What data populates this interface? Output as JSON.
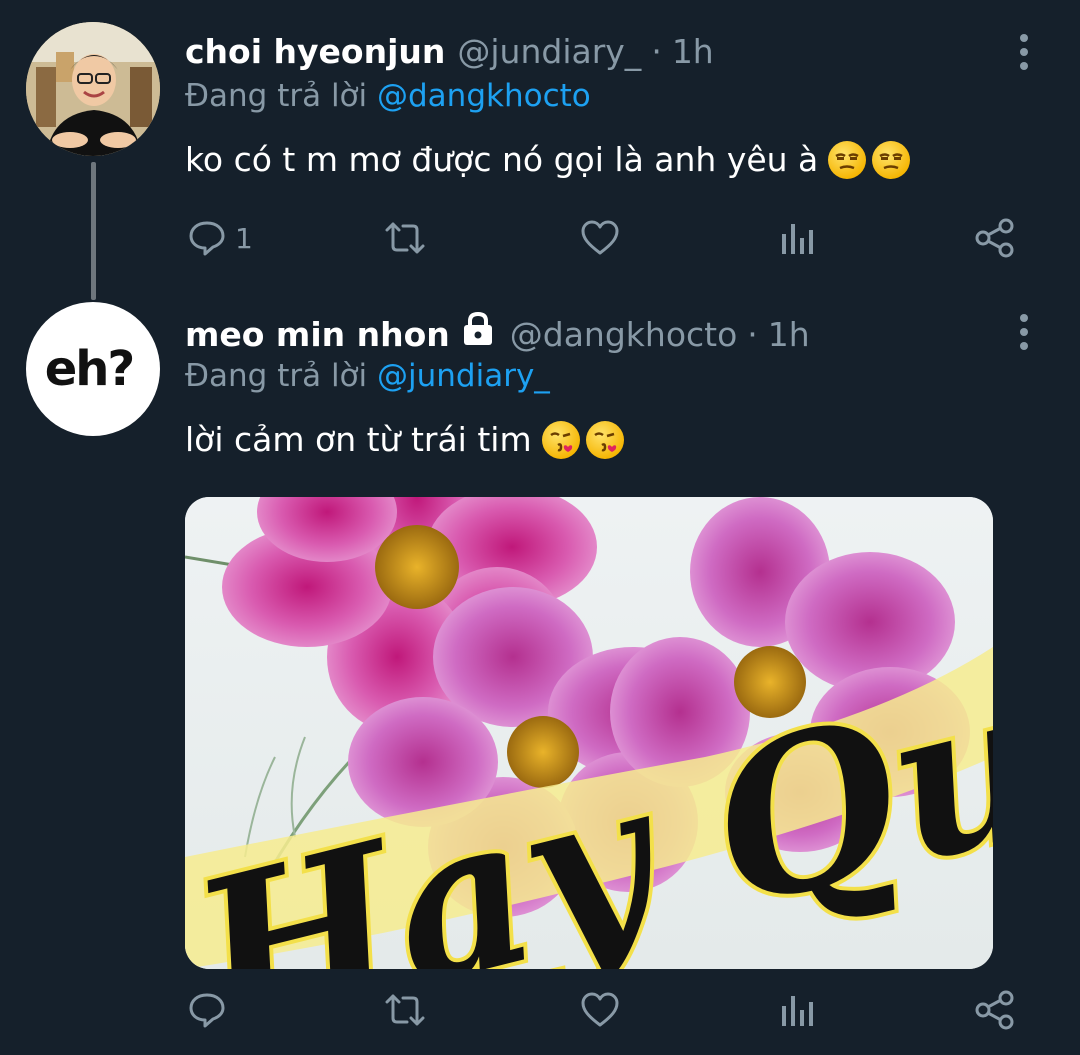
{
  "tweets": [
    {
      "name": "choi hyeonjun",
      "handle": "@jundiary_",
      "dot": "·",
      "time": "1h",
      "reply_prefix": "Đang trả lời",
      "reply_mention": "@dangkhocto",
      "text": "ko có t m mơ được nó gọi là anh yêu à",
      "emojis": [
        "unamused",
        "unamused"
      ],
      "actions": {
        "reply_count": "1"
      },
      "avatar_icon": "user-photo"
    },
    {
      "name": "meo min nhon",
      "protected_icon": "lock-icon",
      "handle": "@dangkhocto",
      "dot": "·",
      "time": "1h",
      "reply_prefix": "Đang trả lời",
      "reply_mention": "@jundiary_",
      "text": "lời cảm ơn từ trái tim",
      "emojis": [
        "kissing-heart",
        "kissing-heart"
      ],
      "avatar_text": "eh?",
      "media": {
        "caption": "Hay Quá"
      }
    }
  ],
  "colors": {
    "background": "#15202b",
    "secondary_text": "#8899a6",
    "link": "#1da1f2"
  }
}
